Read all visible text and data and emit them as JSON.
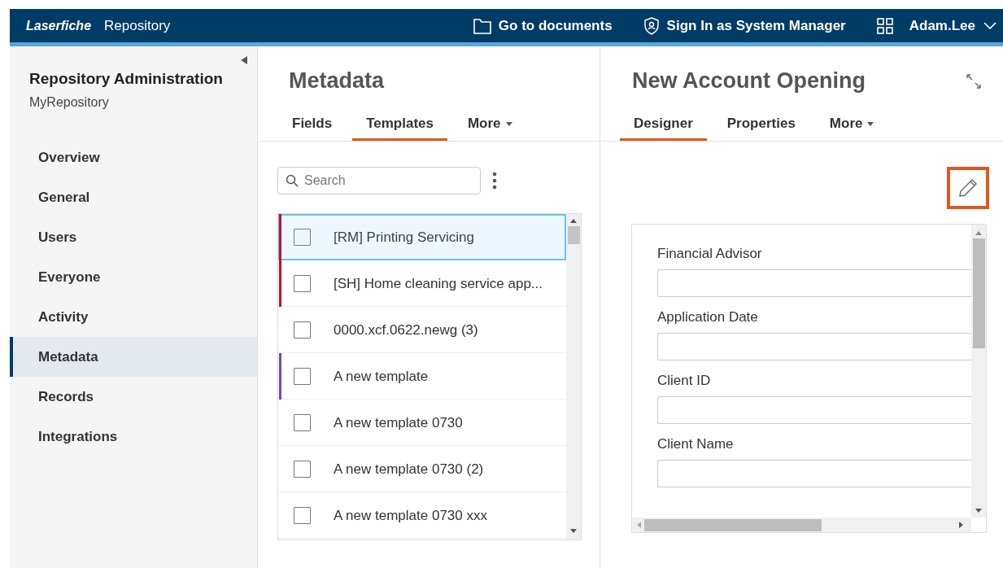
{
  "header": {
    "brand": "Laserfiche",
    "product": "Repository",
    "links": [
      {
        "kind": "folder",
        "label": "Go to documents"
      },
      {
        "kind": "shield",
        "label": "Sign In as System Manager"
      }
    ],
    "user": "Adam.Lee"
  },
  "sidebar": {
    "title": "Repository Administration",
    "subtitle": "MyRepository",
    "items": [
      {
        "label": "Overview",
        "selected": false
      },
      {
        "label": "General",
        "selected": false
      },
      {
        "label": "Users",
        "selected": false
      },
      {
        "label": "Everyone",
        "selected": false
      },
      {
        "label": "Activity",
        "selected": false
      },
      {
        "label": "Metadata",
        "selected": true
      },
      {
        "label": "Records",
        "selected": false
      },
      {
        "label": "Integrations",
        "selected": false
      }
    ]
  },
  "metadata": {
    "title": "Metadata",
    "tabs": [
      {
        "label": "Fields",
        "selected": false,
        "dropdown": false
      },
      {
        "label": "Templates",
        "selected": true,
        "dropdown": false
      },
      {
        "label": "More",
        "selected": false,
        "dropdown": true
      }
    ],
    "search": {
      "placeholder": "Search"
    },
    "templates": [
      {
        "name": "[RM] Printing Servicing",
        "checked": false,
        "selected": true,
        "color": "#c8102e"
      },
      {
        "name": "[SH] Home cleaning service app...",
        "checked": false,
        "selected": false,
        "color": "#c8102e"
      },
      {
        "name": "0000.xcf.0622.newg (3)",
        "checked": false,
        "selected": false
      },
      {
        "name": "A new template",
        "checked": false,
        "selected": false,
        "color": "#6a4bc4"
      },
      {
        "name": "A new template 0730",
        "checked": false,
        "selected": false
      },
      {
        "name": "A new template 0730 (2)",
        "checked": false,
        "selected": false
      },
      {
        "name": "A new template 0730 xxx",
        "checked": false,
        "selected": false
      }
    ]
  },
  "detail": {
    "title": "New Account Opening",
    "tabs": [
      {
        "label": "Designer",
        "selected": true,
        "dropdown": false
      },
      {
        "label": "Properties",
        "selected": false,
        "dropdown": false
      },
      {
        "label": "More",
        "selected": false,
        "dropdown": true
      }
    ],
    "fields": [
      {
        "label": "Financial Advisor"
      },
      {
        "label": "Application Date"
      },
      {
        "label": "Client ID"
      },
      {
        "label": "Client Name"
      }
    ]
  }
}
